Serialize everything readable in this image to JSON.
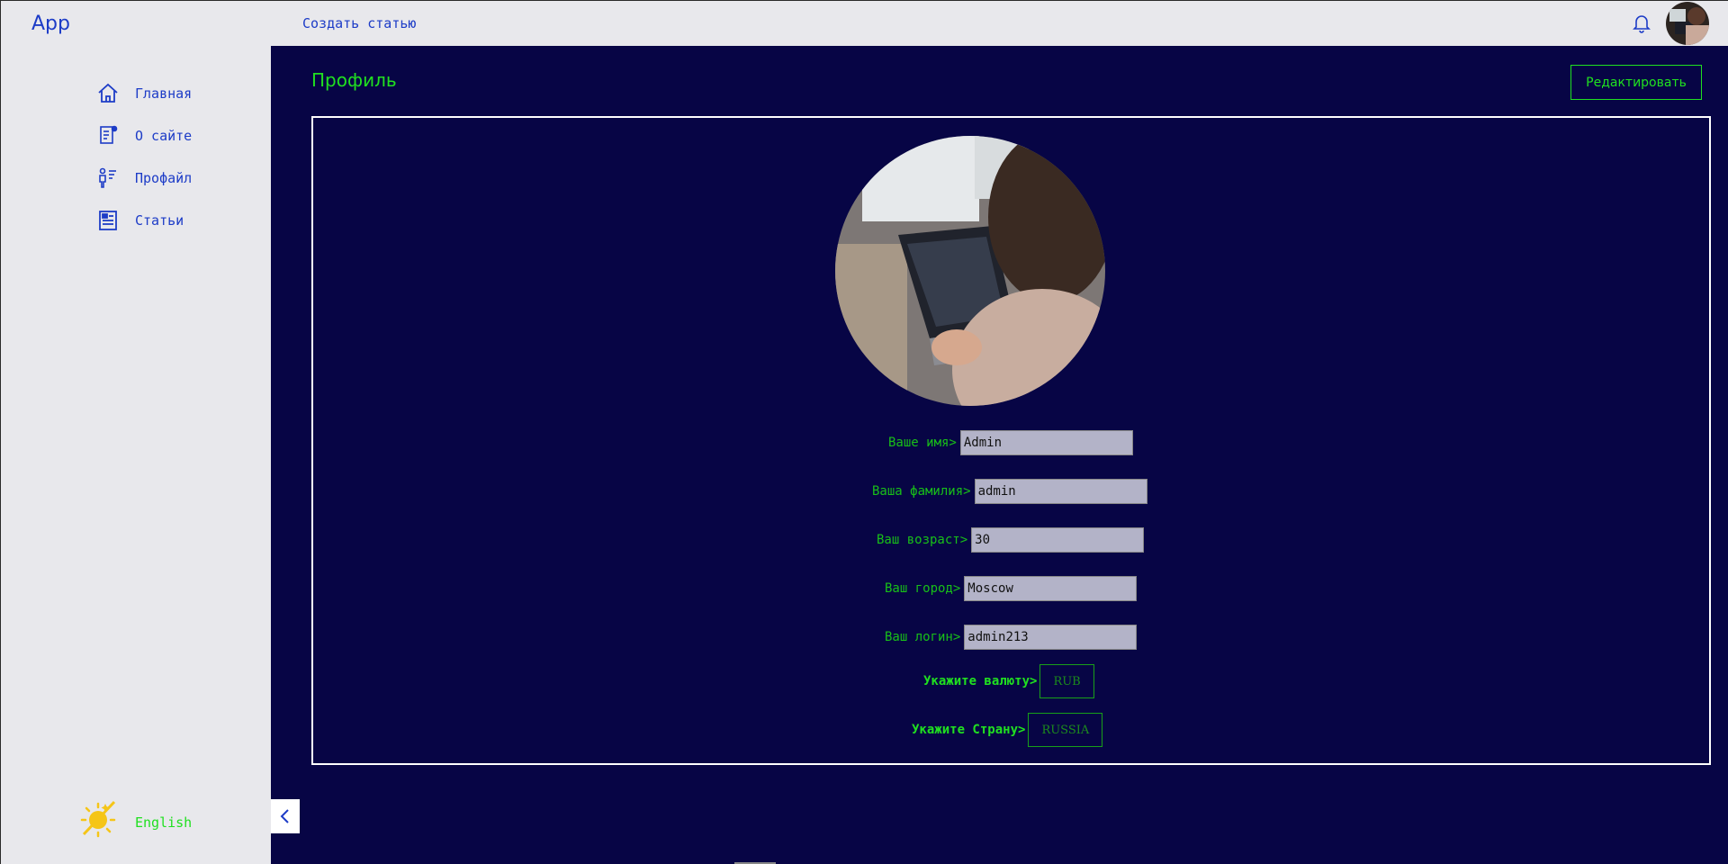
{
  "header": {
    "app_title": "App",
    "create_article": "Создать статью"
  },
  "sidebar": {
    "items": [
      {
        "label": "Главная",
        "icon": "home-icon"
      },
      {
        "label": "О сайте",
        "icon": "about-icon"
      },
      {
        "label": "Профайл",
        "icon": "profile-icon"
      },
      {
        "label": "Статьи",
        "icon": "articles-icon"
      }
    ],
    "language": "English"
  },
  "main": {
    "title": "Профиль",
    "edit_button": "Редактировать"
  },
  "profile": {
    "fields": [
      {
        "label": "Ваше имя>",
        "value": "Admin"
      },
      {
        "label": "Ваша фамилия>",
        "value": "admin"
      },
      {
        "label": "Ваш возраст>",
        "value": "30"
      },
      {
        "label": "Ваш город>",
        "value": "Moscow"
      },
      {
        "label": "Ваш логин>",
        "value": "admin213"
      }
    ],
    "currency_label": "Укажите валюту>",
    "currency_value": "RUB",
    "country_label": "Укажите Страну>",
    "country_value": "RUSSIA"
  },
  "colors": {
    "accent_green": "#20e020",
    "link_blue": "#1d3cc7",
    "main_bg": "#070545",
    "sidebar_bg": "#e8e8ec"
  }
}
